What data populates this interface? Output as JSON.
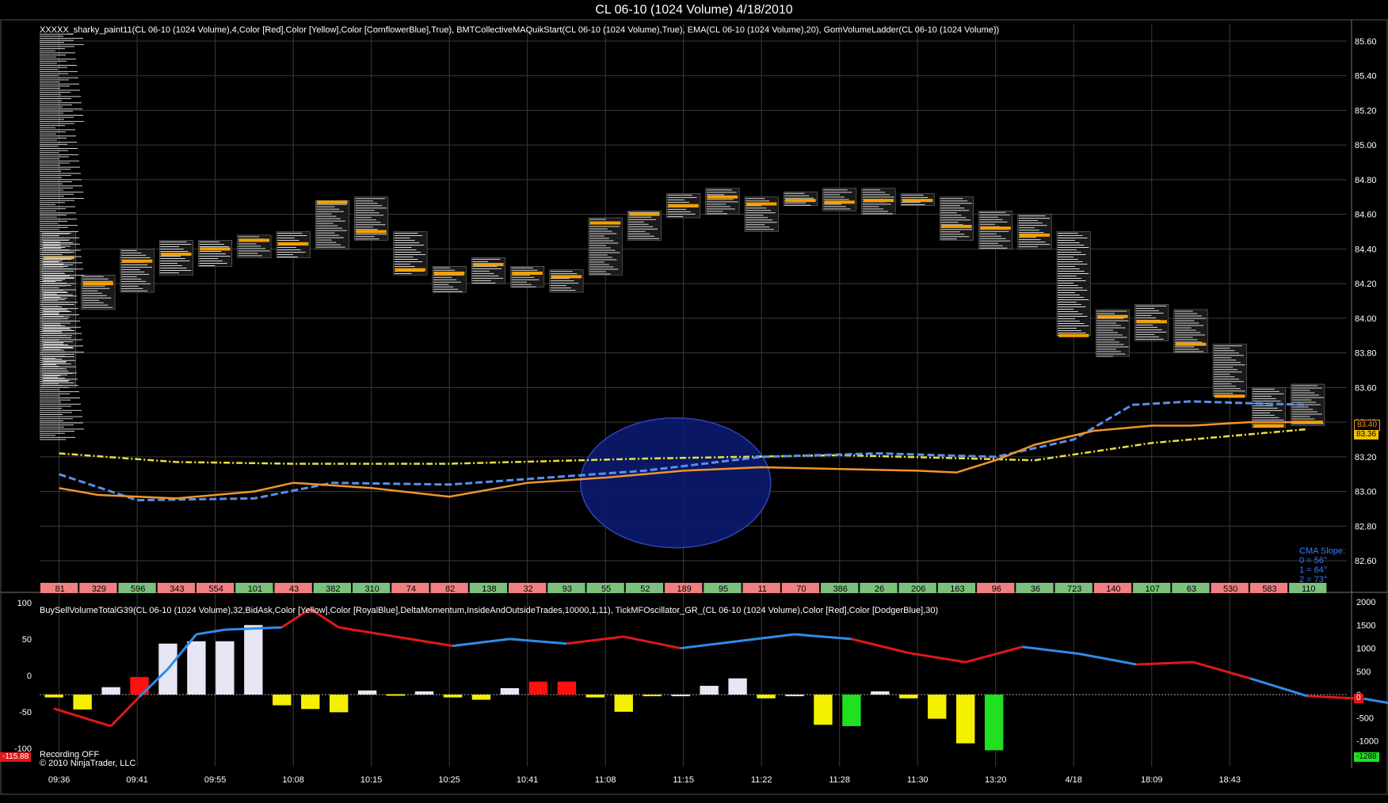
{
  "window": {
    "title": "CL 06-10 (1024 Volume)  4/18/2010"
  },
  "indicators": {
    "price_panel_label": "XXXXX_sharky_paint11(CL 06-10 (1024 Volume),4,Color [Red],Color [Yellow],Color [CornflowerBlue],True), BMTCollectiveMAQuikStart(CL 06-10 (1024 Volume),True), EMA(CL 06-10 (1024 Volume),20), GomVolumeLadder(CL 06-10 (1024 Volume))",
    "lower_panel_label": "BuySellVolumeTotalG39(CL 06-10 (1024 Volume),32,BidAsk,Color [Yellow],Color [RoyalBlue],DeltaMomentum,InsideAndOutsideTrades,10000,1,11), TickMFOscillator_GR_(CL 06-10 (1024 Volume),Color [Red],Color [DodgerBlue],30)"
  },
  "cma_slope": {
    "title": "CMA Slope:",
    "lines": [
      "0 = 56°",
      "1 = 64°",
      "2 = 73°"
    ]
  },
  "status": {
    "recording": "Recording OFF",
    "copyright": "© 2010 NinjaTrader, LLC"
  },
  "badges": {
    "price_ema": "83.40",
    "price_last": "83.36",
    "lower_left": "-115.88",
    "lower_right_top": "0",
    "lower_right_bottom": "-1288"
  },
  "colors": {
    "background": "#000000",
    "grid": "#3a3a3a",
    "ema": "#f0962a",
    "ma_blue": "#5a8ee8",
    "ma_yellow": "#e8e040",
    "osc_red": "#e01818",
    "osc_blue": "#2f8ce8",
    "bar_yellow": "#f5f000",
    "bar_white": "#e6e6f5",
    "bar_red": "#ff1010",
    "bar_green": "#20e020",
    "ellipse": "#0c1a6e"
  },
  "chart_data": [
    {
      "type": "price_ladder",
      "ylim": [
        82.5,
        85.7
      ],
      "y_ticks": [
        "85.60",
        "85.40",
        "85.20",
        "85.00",
        "84.80",
        "84.60",
        "84.40",
        "84.20",
        "84.00",
        "83.80",
        "83.60",
        "83.40",
        "83.20",
        "83.00",
        "82.80",
        "82.60"
      ],
      "x_tick_labels": [
        "09:36",
        "09:41",
        "09:55",
        "10:08",
        "10:15",
        "10:25",
        "10:41",
        "11:08",
        "11:15",
        "11:22",
        "11:28",
        "11:30",
        "13:20",
        "4/18",
        "18:09",
        "18:43"
      ],
      "bars": [
        {
          "lo": 83.6,
          "hi": 84.5,
          "poc": 84.35
        },
        {
          "lo": 84.05,
          "hi": 84.25,
          "poc": 84.2
        },
        {
          "lo": 84.15,
          "hi": 84.4,
          "poc": 84.33
        },
        {
          "lo": 84.25,
          "hi": 84.45,
          "poc": 84.37
        },
        {
          "lo": 84.3,
          "hi": 84.45,
          "poc": 84.4
        },
        {
          "lo": 84.35,
          "hi": 84.48,
          "poc": 84.45
        },
        {
          "lo": 84.35,
          "hi": 84.5,
          "poc": 84.43
        },
        {
          "lo": 84.4,
          "hi": 84.68,
          "poc": 84.67
        },
        {
          "lo": 84.45,
          "hi": 84.7,
          "poc": 84.5
        },
        {
          "lo": 84.25,
          "hi": 84.5,
          "poc": 84.28
        },
        {
          "lo": 84.15,
          "hi": 84.3,
          "poc": 84.26
        },
        {
          "lo": 84.2,
          "hi": 84.35,
          "poc": 84.31
        },
        {
          "lo": 84.18,
          "hi": 84.3,
          "poc": 84.26
        },
        {
          "lo": 84.15,
          "hi": 84.28,
          "poc": 84.24
        },
        {
          "lo": 84.25,
          "hi": 84.58,
          "poc": 84.55
        },
        {
          "lo": 84.45,
          "hi": 84.62,
          "poc": 84.6
        },
        {
          "lo": 84.58,
          "hi": 84.72,
          "poc": 84.65
        },
        {
          "lo": 84.6,
          "hi": 84.75,
          "poc": 84.7
        },
        {
          "lo": 84.5,
          "hi": 84.7,
          "poc": 84.66
        },
        {
          "lo": 84.65,
          "hi": 84.73,
          "poc": 84.68
        },
        {
          "lo": 84.62,
          "hi": 84.75,
          "poc": 84.67
        },
        {
          "lo": 84.6,
          "hi": 84.75,
          "poc": 84.68
        },
        {
          "lo": 84.65,
          "hi": 84.72,
          "poc": 84.68
        },
        {
          "lo": 84.45,
          "hi": 84.7,
          "poc": 84.53
        },
        {
          "lo": 84.4,
          "hi": 84.62,
          "poc": 84.52
        },
        {
          "lo": 84.4,
          "hi": 84.6,
          "poc": 84.48
        },
        {
          "lo": 83.9,
          "hi": 84.5,
          "poc": 83.9
        },
        {
          "lo": 83.78,
          "hi": 84.05,
          "poc": 84.01
        },
        {
          "lo": 83.87,
          "hi": 84.08,
          "poc": 83.98
        },
        {
          "lo": 83.8,
          "hi": 84.05,
          "poc": 83.85
        },
        {
          "lo": 83.55,
          "hi": 83.85,
          "poc": 83.55
        },
        {
          "lo": 83.37,
          "hi": 83.6,
          "poc": 83.38
        },
        {
          "lo": 83.38,
          "hi": 83.62,
          "poc": 83.4
        }
      ],
      "ema": [
        [
          0,
          83.02
        ],
        [
          2,
          82.98
        ],
        [
          6,
          82.96
        ],
        [
          10,
          83.0
        ],
        [
          12,
          83.05
        ],
        [
          16,
          83.02
        ],
        [
          20,
          82.97
        ],
        [
          24,
          83.05
        ],
        [
          28,
          83.08
        ],
        [
          32,
          83.12
        ],
        [
          36,
          83.14
        ],
        [
          40,
          83.13
        ],
        [
          44,
          83.12
        ],
        [
          46,
          83.11
        ],
        [
          48,
          83.18
        ],
        [
          50,
          83.27
        ],
        [
          53,
          83.35
        ],
        [
          56,
          83.38
        ],
        [
          58,
          83.38
        ],
        [
          61,
          83.4
        ],
        [
          64,
          83.4
        ]
      ],
      "ma_blue": [
        [
          0,
          83.1
        ],
        [
          4,
          82.95
        ],
        [
          10,
          82.96
        ],
        [
          14,
          83.05
        ],
        [
          20,
          83.04
        ],
        [
          30,
          83.12
        ],
        [
          36,
          83.2
        ],
        [
          42,
          83.22
        ],
        [
          48,
          83.2
        ],
        [
          52,
          83.3
        ],
        [
          55,
          83.5
        ],
        [
          58,
          83.52
        ],
        [
          64,
          83.5
        ]
      ],
      "ma_yellow": [
        [
          0,
          83.22
        ],
        [
          6,
          83.17
        ],
        [
          12,
          83.16
        ],
        [
          20,
          83.16
        ],
        [
          30,
          83.19
        ],
        [
          40,
          83.21
        ],
        [
          50,
          83.18
        ],
        [
          56,
          83.28
        ],
        [
          64,
          83.36
        ]
      ],
      "volume_counts": [
        "81",
        "329",
        "596",
        "343",
        "554",
        "101",
        "43",
        "382",
        "310",
        "74",
        "82",
        "138",
        "32",
        "93",
        "55",
        "52",
        "189",
        "95",
        "11",
        "70",
        "386",
        "26",
        "206",
        "163",
        "96",
        "36",
        "723",
        "140",
        "107",
        "63",
        "530",
        "583",
        "110"
      ]
    },
    {
      "type": "bar",
      "left_axis": [
        "100",
        "50",
        "0",
        "-50",
        "-100"
      ],
      "right_axis": [
        "2000",
        "1500",
        "1000",
        "500",
        "0",
        "-500",
        "-1000"
      ],
      "ylim": [
        -1500,
        2000
      ],
      "values": [
        -60,
        -320,
        160,
        380,
        1100,
        1150,
        1150,
        1500,
        -230,
        -310,
        -380,
        90,
        10,
        70,
        -60,
        -110,
        140,
        280,
        280,
        -60,
        -370,
        -10,
        -10,
        190,
        350,
        -80,
        -10,
        -650,
        -680,
        70,
        -80,
        -520,
        -1050,
        -1200
      ],
      "colors": [
        "y",
        "y",
        "w",
        "r",
        "w",
        "w",
        "w",
        "w",
        "y",
        "y",
        "y",
        "w",
        "y",
        "w",
        "y",
        "y",
        "w",
        "r",
        "r",
        "y",
        "y",
        "y",
        "w",
        "w",
        "w",
        "y",
        "w",
        "y",
        "g",
        "w",
        "y",
        "y",
        "y",
        "g"
      ],
      "oscillator": [
        [
          0,
          -300
        ],
        [
          2,
          -680
        ],
        [
          3,
          -50
        ],
        [
          4,
          550
        ],
        [
          5,
          1300
        ],
        [
          6,
          1400
        ],
        [
          8,
          1450
        ],
        [
          9,
          1850
        ],
        [
          10,
          1450
        ],
        [
          14,
          1050
        ],
        [
          16,
          1200
        ],
        [
          18,
          1100
        ],
        [
          20,
          1250
        ],
        [
          22,
          1000
        ],
        [
          24,
          1150
        ],
        [
          26,
          1300
        ],
        [
          28,
          1200
        ],
        [
          30,
          900
        ],
        [
          32,
          700
        ],
        [
          34,
          1030
        ],
        [
          36,
          880
        ],
        [
          38,
          650
        ],
        [
          40,
          700
        ],
        [
          42,
          350
        ],
        [
          44,
          -30
        ],
        [
          46,
          -90
        ],
        [
          48,
          -300
        ],
        [
          50,
          -1100
        ],
        [
          52,
          -1180
        ]
      ],
      "osc_colors": [
        "r",
        "r",
        "b",
        "b",
        "b",
        "b",
        "r",
        "r",
        "r",
        "b",
        "b",
        "r",
        "r",
        "b",
        "b",
        "b",
        "r",
        "r",
        "r",
        "b",
        "b",
        "r",
        "r",
        "b",
        "r",
        "b",
        "r",
        "r"
      ]
    }
  ]
}
